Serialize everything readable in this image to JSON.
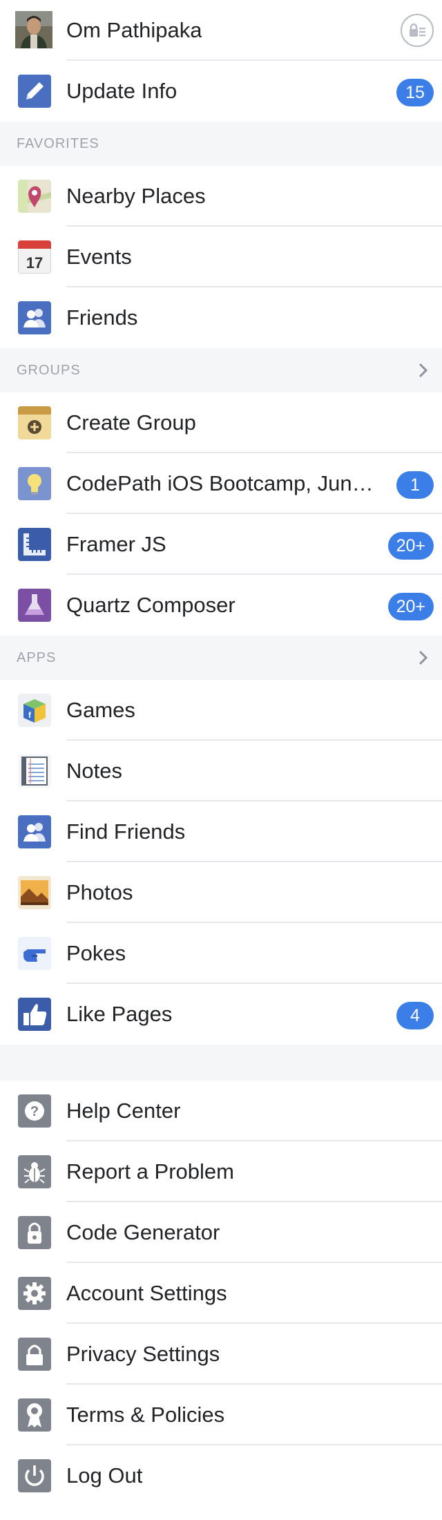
{
  "profile": {
    "name": "Om Pathipaka",
    "action": "privacy-shortcut-icon"
  },
  "update_info": {
    "label": "Update Info",
    "badge": "15",
    "icon": "pencil-icon"
  },
  "favorites": {
    "title": "FAVORITES",
    "items": [
      {
        "label": "Nearby Places",
        "icon": "map-pin-icon"
      },
      {
        "label": "Events",
        "icon": "calendar-icon",
        "icon_text": "17"
      },
      {
        "label": "Friends",
        "icon": "friends-icon"
      }
    ]
  },
  "groups": {
    "title": "GROUPS",
    "items": [
      {
        "label": "Create Group",
        "icon": "create-group-icon"
      },
      {
        "label": "CodePath iOS Bootcamp, Jun…",
        "badge": "1",
        "icon": "lightbulb-icon"
      },
      {
        "label": "Framer JS",
        "badge": "20+",
        "icon": "ruler-icon"
      },
      {
        "label": "Quartz Composer",
        "badge": "20+",
        "icon": "flask-icon"
      }
    ]
  },
  "apps": {
    "title": "APPS",
    "items": [
      {
        "label": "Games",
        "icon": "games-cube-icon"
      },
      {
        "label": "Notes",
        "icon": "notepad-icon"
      },
      {
        "label": "Find Friends",
        "icon": "find-friends-icon"
      },
      {
        "label": "Photos",
        "icon": "photo-icon"
      },
      {
        "label": "Pokes",
        "icon": "poke-hand-icon"
      },
      {
        "label": "Like Pages",
        "badge": "4",
        "icon": "thumbs-up-icon"
      }
    ]
  },
  "settings": {
    "items": [
      {
        "label": "Help Center",
        "icon": "question-icon"
      },
      {
        "label": "Report a Problem",
        "icon": "bug-icon"
      },
      {
        "label": "Code Generator",
        "icon": "code-lock-icon"
      },
      {
        "label": "Account Settings",
        "icon": "gear-icon"
      },
      {
        "label": "Privacy Settings",
        "icon": "padlock-icon"
      },
      {
        "label": "Terms & Policies",
        "icon": "ribbon-icon"
      },
      {
        "label": "Log Out",
        "icon": "power-icon"
      }
    ]
  },
  "colors": {
    "badge": "#3b7ee8",
    "section_bg": "#f5f6f8",
    "section_text": "#9ea2aa",
    "divider": "#e6e7ea"
  }
}
